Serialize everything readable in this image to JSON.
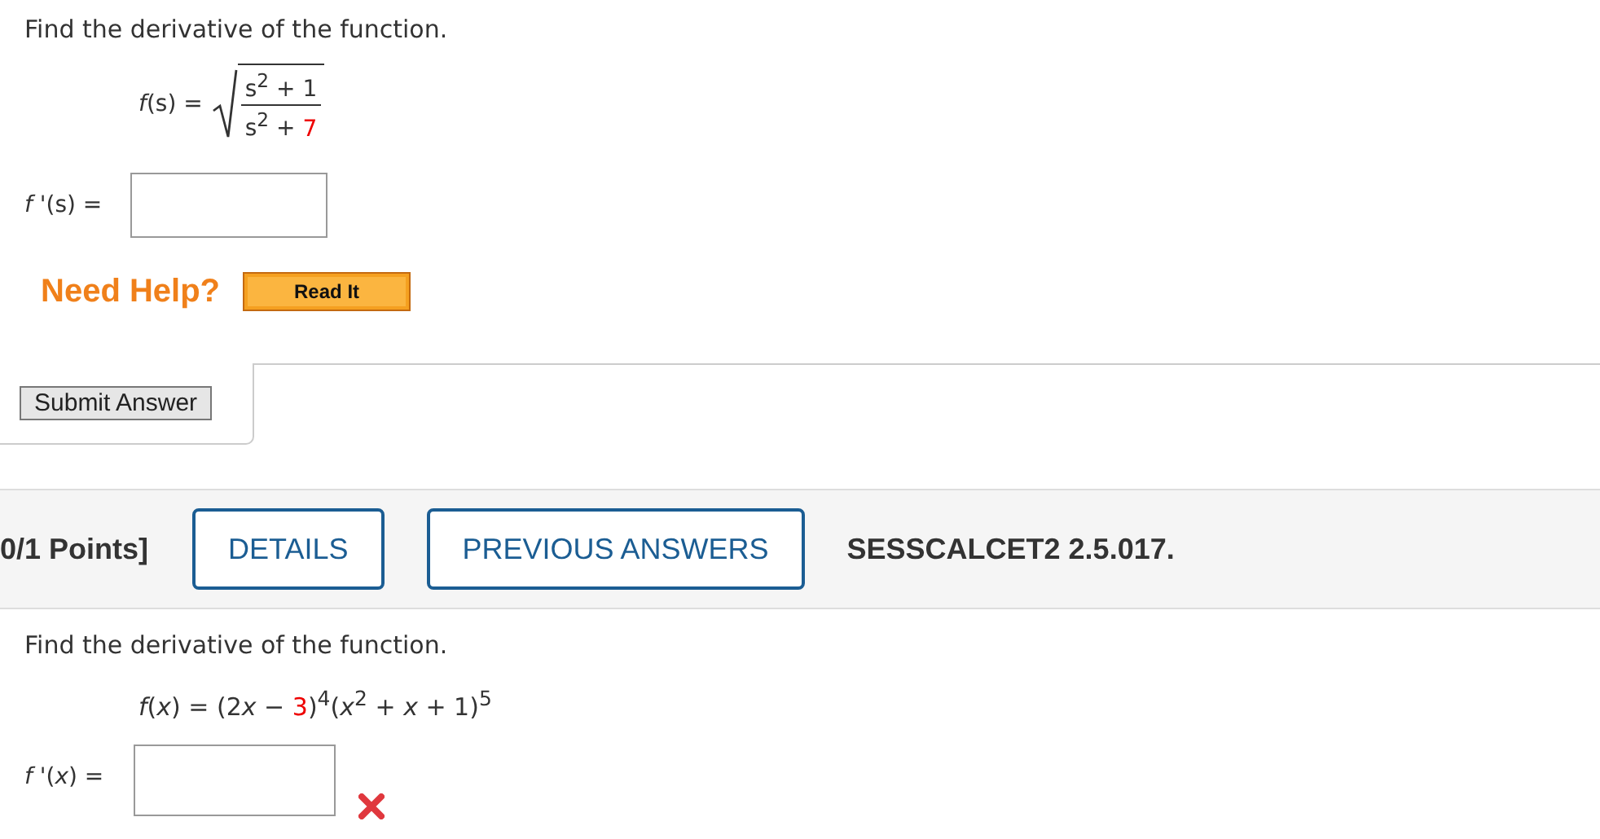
{
  "problem_1": {
    "prompt": "Find the derivative of the function.",
    "function": {
      "lhs": "*f*(s) =",
      "numerator": [
        {
          "text": "s$^{2}$ + 1",
          "highlight": false
        }
      ],
      "denominator": [
        {
          "text": "s$^{2}$ + ",
          "highlight": false
        },
        {
          "text": "7",
          "highlight": true
        }
      ]
    },
    "answer": {
      "label": "*f* '(s) =",
      "incorrect": false
    }
  },
  "help": {
    "label": "Need Help?",
    "buttons": [
      "Read It"
    ]
  },
  "submit_button": "Submit Answer",
  "header": {
    "points": "0/1 Points]",
    "buttons": [
      "DETAILS",
      "PREVIOUS ANSWERS"
    ],
    "reference": "SESSCALCET2 2.5.017."
  },
  "problem_2": {
    "prompt": "Find the derivative of the function.",
    "function": {
      "pieces": [
        {
          "text": "*f*(*x*) = (2",
          "highlight": false
        },
        {
          "text": "*x* − ",
          "highlight": false
        },
        {
          "text": "3",
          "highlight": true
        },
        {
          "text": ")$^{4}$(*x*$^{2}$ + *x* + 1)$^{5}$",
          "highlight": false
        }
      ]
    },
    "answer": {
      "label": "*f* '(*x*) =",
      "incorrect": true
    }
  }
}
